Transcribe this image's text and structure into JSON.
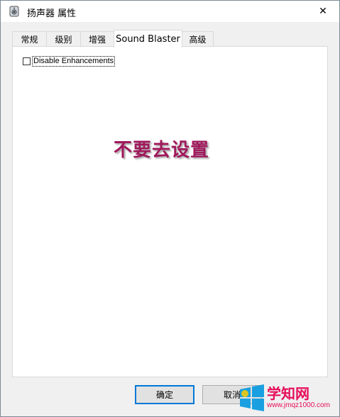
{
  "window": {
    "title": "扬声器 属性",
    "close_glyph": "✕"
  },
  "tabs": [
    {
      "label": "常规"
    },
    {
      "label": "级别"
    },
    {
      "label": "增强"
    },
    {
      "label": "Sound Blaster",
      "active": true
    },
    {
      "label": "高级"
    }
  ],
  "panel": {
    "checkbox_label": "Disable Enhancements",
    "checkbox_checked": false,
    "annotation_text": "不要去设置"
  },
  "buttons": {
    "ok_label": "确定",
    "cancel_label": "取消"
  },
  "watermark": {
    "brand": "学知网",
    "url": "www.jmqz1000.com"
  },
  "colors": {
    "annotation": "#a0185c",
    "accent_border": "#0078d7",
    "watermark": "#e60e5a"
  },
  "icons": {
    "title_icon": "speaker-properties-icon",
    "close_icon": "close-icon",
    "watermark_logo": "windows-logo-icon"
  }
}
